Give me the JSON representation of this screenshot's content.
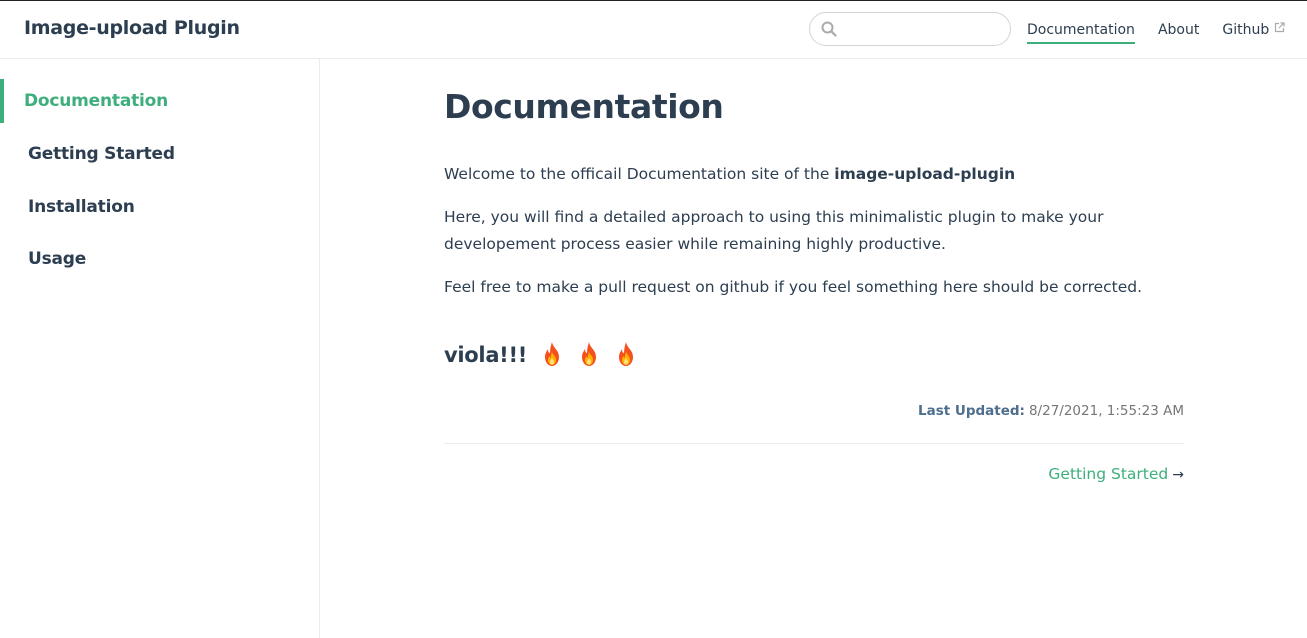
{
  "header": {
    "site_name": "Image-upload Plugin",
    "search": {
      "value": "",
      "placeholder": ""
    },
    "nav": [
      {
        "label": "Documentation",
        "active": true
      },
      {
        "label": "About"
      },
      {
        "label": "Github",
        "external": true
      }
    ]
  },
  "sidebar": {
    "items": [
      {
        "label": "Documentation",
        "active": true
      },
      {
        "label": "Getting Started"
      },
      {
        "label": "Installation"
      },
      {
        "label": "Usage"
      }
    ]
  },
  "content": {
    "title": "Documentation",
    "para1_text": "Welcome to the officail Documentation site of the ",
    "para1_strong": "image-upload-plugin",
    "para2": "Here, you will find a detailed approach to using this minimalistic plugin to make your developement process easier while remaining highly productive.",
    "para3": "Feel free to make a pull request on github if you feel something here should be corrected.",
    "viola": "viola!!!",
    "last_updated_label": "Last Updated:",
    "last_updated_value": "8/27/2021, 1:55:23 AM",
    "next_link": "Getting Started",
    "next_arrow": "→"
  },
  "colors": {
    "accent": "#3eaf7c",
    "text": "#2c3e50",
    "border": "#eaecef"
  },
  "icons": [
    "search-icon",
    "external-link-icon",
    "fire-icon"
  ]
}
